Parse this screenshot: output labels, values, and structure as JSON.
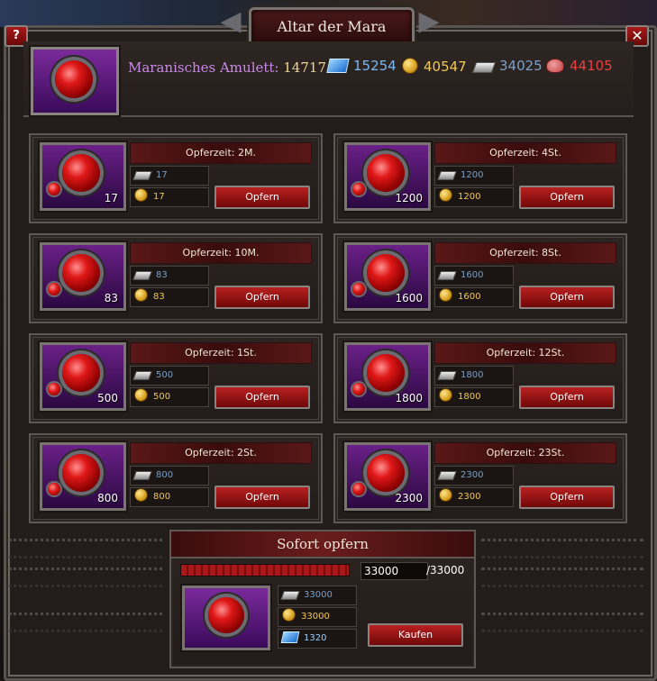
{
  "window": {
    "title": "Altar der Mara",
    "help_label": "?",
    "close_label": "✕"
  },
  "header": {
    "amulet_label": "Maranisches Amulett:",
    "amulet_count": "14717",
    "resources": [
      {
        "icon": "gem-icon",
        "value": "15254",
        "color": "#7ab8f0"
      },
      {
        "icon": "gold-coin-icon",
        "value": "40547",
        "color": "#f0c850"
      },
      {
        "icon": "silver-bar-icon",
        "value": "34025",
        "color": "#7aa0c8"
      },
      {
        "icon": "meat-icon",
        "value": "44105",
        "color": "#e84040"
      }
    ]
  },
  "offerings": [
    {
      "time": "Opferzeit: 2M.",
      "amount": "17",
      "silver": "17",
      "gold": "17",
      "button": "Opfern"
    },
    {
      "time": "Opferzeit: 4St.",
      "amount": "1200",
      "silver": "1200",
      "gold": "1200",
      "button": "Opfern"
    },
    {
      "time": "Opferzeit: 10M.",
      "amount": "83",
      "silver": "83",
      "gold": "83",
      "button": "Opfern"
    },
    {
      "time": "Opferzeit: 8St.",
      "amount": "1600",
      "silver": "1600",
      "gold": "1600",
      "button": "Opfern"
    },
    {
      "time": "Opferzeit: 1St.",
      "amount": "500",
      "silver": "500",
      "gold": "500",
      "button": "Opfern"
    },
    {
      "time": "Opferzeit: 12St.",
      "amount": "1800",
      "silver": "1800",
      "gold": "1800",
      "button": "Opfern"
    },
    {
      "time": "Opferzeit: 2St.",
      "amount": "800",
      "silver": "800",
      "gold": "800",
      "button": "Opfern"
    },
    {
      "time": "Opferzeit: 23St.",
      "amount": "2300",
      "silver": "2300",
      "gold": "2300",
      "button": "Opfern"
    }
  ],
  "instant": {
    "title": "Sofort opfern",
    "progress_fraction": 1.0,
    "quantity": "33000",
    "max": "/33000",
    "silver": "33000",
    "gold": "33000",
    "gems": "1320",
    "button": "Kaufen"
  }
}
